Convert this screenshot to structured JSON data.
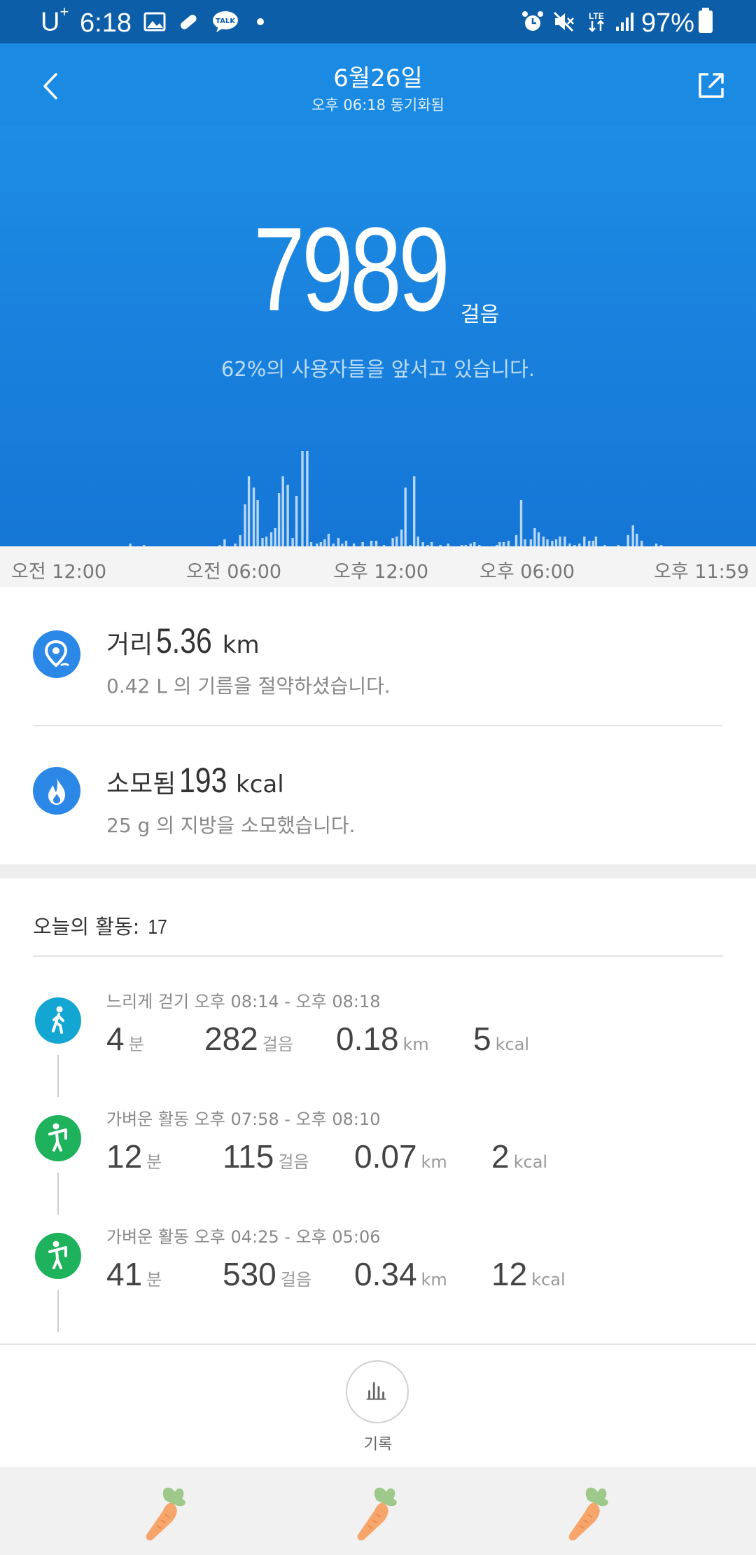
{
  "status_bar": {
    "carrier": "U",
    "carrier_sup": "+",
    "time": "6:18",
    "battery": "97%"
  },
  "header": {
    "title": "6월26일",
    "subtitle": "오후 06:18 동기화됨"
  },
  "summary": {
    "steps": "7989",
    "steps_unit": "걸음",
    "percentile_text": "62%의 사용자들을 앞서고 있습니다."
  },
  "chart_data": {
    "type": "bar",
    "x_labels": [
      "오전 12:00",
      "오전 06:00",
      "오후 12:00",
      "오후 06:00",
      "오후 11:59"
    ],
    "x": [
      104,
      118,
      196,
      201,
      209,
      212,
      217,
      222,
      226,
      231,
      235,
      240,
      244,
      249,
      253,
      257,
      261,
      266,
      271,
      275,
      281,
      286,
      290,
      296,
      300,
      304,
      308,
      313,
      318,
      322,
      326,
      330,
      334,
      339,
      343,
      348,
      352,
      357,
      361,
      365,
      370,
      374,
      378,
      383,
      387,
      392,
      396,
      400,
      405,
      410,
      414,
      418,
      423,
      427,
      431,
      436,
      440,
      445,
      449,
      454,
      458,
      463,
      468,
      472,
      476,
      481,
      484,
      488,
      493,
      497,
      501,
      506,
      510,
      516,
      520,
      524,
      529,
      533,
      538,
      542,
      546,
      551,
      556,
      561,
      566,
      571,
      576,
      580,
      583,
      587,
      592,
      597,
      602,
      606,
      611,
      616,
      621,
      625,
      630,
      635,
      640,
      645,
      650,
      655
    ],
    "values": [
      2,
      1,
      1,
      5,
      0,
      2,
      8,
      30,
      50,
      42,
      33,
      6,
      7,
      10,
      13,
      38,
      50,
      44,
      6,
      36,
      68,
      68,
      3,
      2,
      3,
      5,
      9,
      2,
      6,
      2,
      4,
      0,
      2,
      0,
      3,
      0,
      4,
      4,
      0,
      1,
      0,
      6,
      7,
      12,
      42,
      1,
      50,
      7,
      3,
      1,
      3,
      0,
      1,
      0,
      2,
      0,
      0,
      1,
      1,
      2,
      3,
      1,
      0,
      0,
      0,
      1,
      3,
      3,
      4,
      0,
      8,
      33,
      5,
      5,
      13,
      10,
      7,
      5,
      4,
      5,
      7,
      7,
      2,
      1,
      2,
      7,
      4,
      4,
      7,
      0,
      1,
      0,
      0,
      1,
      0,
      8,
      15,
      9,
      4,
      0,
      0,
      2,
      1,
      0
    ],
    "ylim": [
      0,
      100
    ],
    "grid": false
  },
  "metrics": [
    {
      "label": "거리",
      "value": "5.36",
      "unit": "km",
      "sub": "0.42 L 의 기름을 절약하셨습니다.",
      "icon": "location-pin-icon"
    },
    {
      "label": "소모됨",
      "value": "193",
      "unit": "kcal",
      "sub": "25 g 의 지방을 소모했습니다.",
      "icon": "flame-icon"
    }
  ],
  "activities": {
    "header_label": "오늘의 활동:",
    "count": "17",
    "items": [
      {
        "title": "느리게 걷기 오후 08:14 - 오후 08:18",
        "minutes": "4",
        "minutes_unit": "분",
        "steps": "282",
        "steps_unit": "걸음",
        "distance": "0.18",
        "distance_unit": "km",
        "calories": "5",
        "calories_unit": "kcal",
        "icon": "walking-person-icon",
        "color": "#13a6d3"
      },
      {
        "title": "가벼운 활동 오후 07:58 - 오후 08:10",
        "minutes": "12",
        "minutes_unit": "분",
        "steps": "115",
        "steps_unit": "걸음",
        "distance": "0.07",
        "distance_unit": "km",
        "calories": "2",
        "calories_unit": "kcal",
        "icon": "light-activity-person-icon",
        "color": "#1db25b"
      },
      {
        "title": "가벼운 활동 오후 04:25 - 오후 05:06",
        "minutes": "41",
        "minutes_unit": "분",
        "steps": "530",
        "steps_unit": "걸음",
        "distance": "0.34",
        "distance_unit": "km",
        "calories": "12",
        "calories_unit": "kcal",
        "icon": "light-activity-person-icon",
        "color": "#1db25b"
      }
    ]
  },
  "bottom": {
    "record_label": "기록"
  },
  "colors": {
    "status_bar": "#0c5ea8",
    "app_bar": "#1b8ae2",
    "hero": "#1d8ce4",
    "accent_blue": "#2b88e6"
  }
}
